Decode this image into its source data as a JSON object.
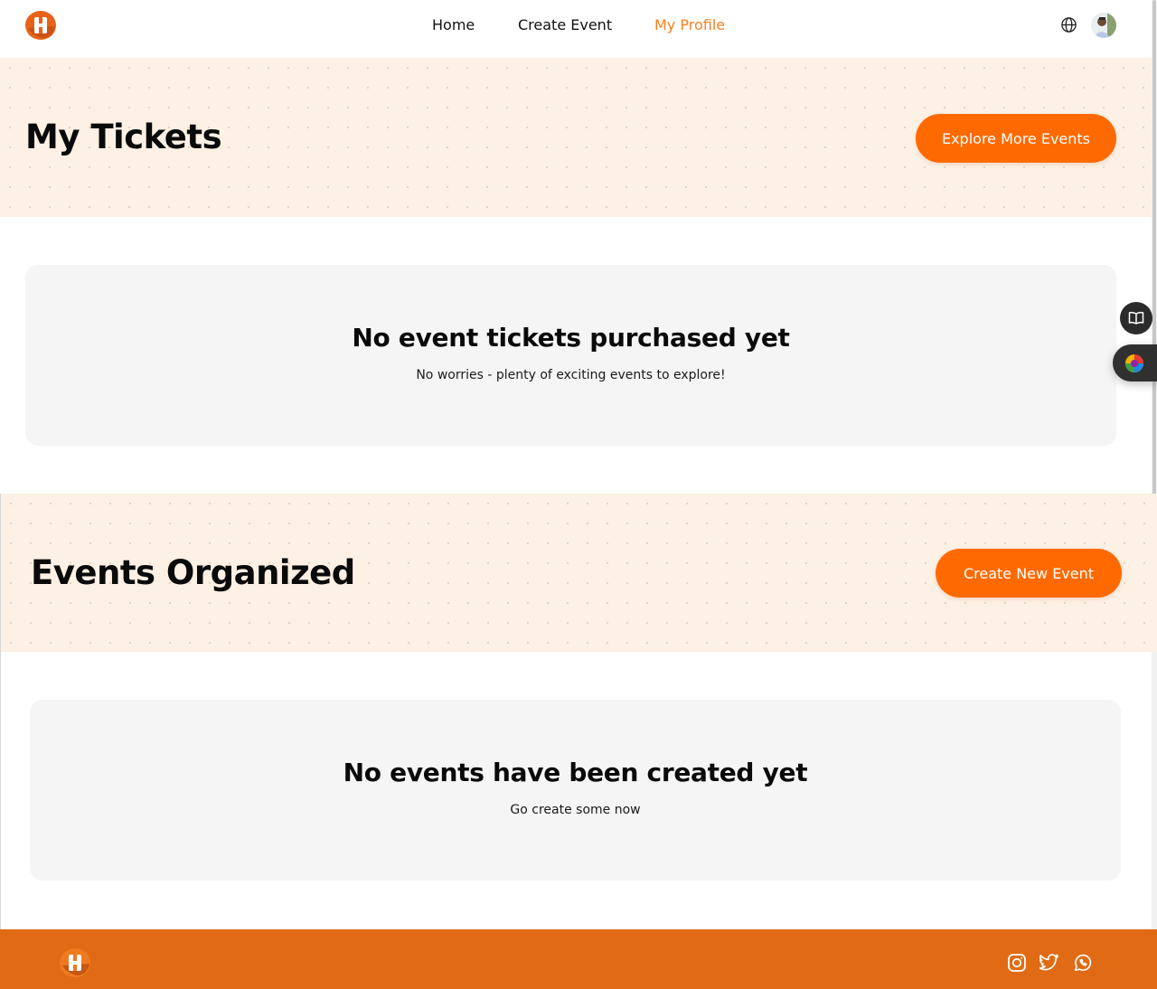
{
  "nav": {
    "home": "Home",
    "create_event": "Create Event",
    "my_profile": "My Profile"
  },
  "icons": {
    "logo": "brand-logo",
    "language": "globe-icon",
    "avatar": "user-avatar",
    "book": "book-open-icon",
    "theme": "color-palette-icon",
    "instagram": "instagram-icon",
    "twitter": "twitter-icon",
    "whatsapp": "whatsapp-icon"
  },
  "colors": {
    "accent": "#ff6a00",
    "nav_active": "#f58220",
    "hero_bg": "#fdf0e4",
    "card_bg": "#f5f5f5",
    "footer_bg": "#e06b14"
  },
  "tickets": {
    "title": "My Tickets",
    "button": "Explore More Events",
    "empty_title": "No event tickets purchased yet",
    "empty_text": "No worries - plenty of exciting events to explore!"
  },
  "organized": {
    "title": "Events Organized",
    "button": "Create New Event",
    "empty_title": "No events have been created yet",
    "empty_text": "Go create some now"
  }
}
